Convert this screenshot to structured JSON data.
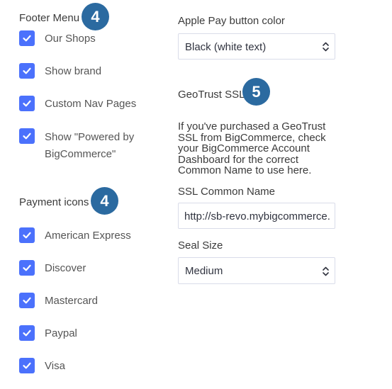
{
  "footer_menu": {
    "title": "Footer Menu",
    "step": "4",
    "items": [
      {
        "label": "Our Shops",
        "checked": true
      },
      {
        "label": "Show brand",
        "checked": true
      },
      {
        "label": "Custom Nav Pages",
        "checked": true
      },
      {
        "label": "Show \"Powered by BigCommerce\"",
        "checked": true
      }
    ]
  },
  "payment_icons": {
    "title": "Payment icons",
    "step": "4",
    "items": [
      {
        "label": "American Express",
        "checked": true
      },
      {
        "label": "Discover",
        "checked": true
      },
      {
        "label": "Mastercard",
        "checked": true
      },
      {
        "label": "Paypal",
        "checked": true
      },
      {
        "label": "Visa",
        "checked": true
      }
    ]
  },
  "apple_pay": {
    "label": "Apple Pay button color",
    "value": "Black (white text)"
  },
  "geotrust": {
    "title": "GeoTrust SSL",
    "step": "5",
    "help": "If you've purchased a GeoTrust SSL from BigCommerce, check your BigCommerce Account Dashboard for the correct Common Name to use here.",
    "common_name_label": "SSL Common Name",
    "common_name_value": "http://sb-revo.mybigcommerce.com",
    "seal_size_label": "Seal Size",
    "seal_size_value": "Medium"
  },
  "colors": {
    "checkbox": "#4b71fc",
    "badge": "#2b6aa0",
    "input_border": "#d9dce9"
  },
  "icons": [
    "checkmark-icon",
    "select-arrows-icon"
  ]
}
